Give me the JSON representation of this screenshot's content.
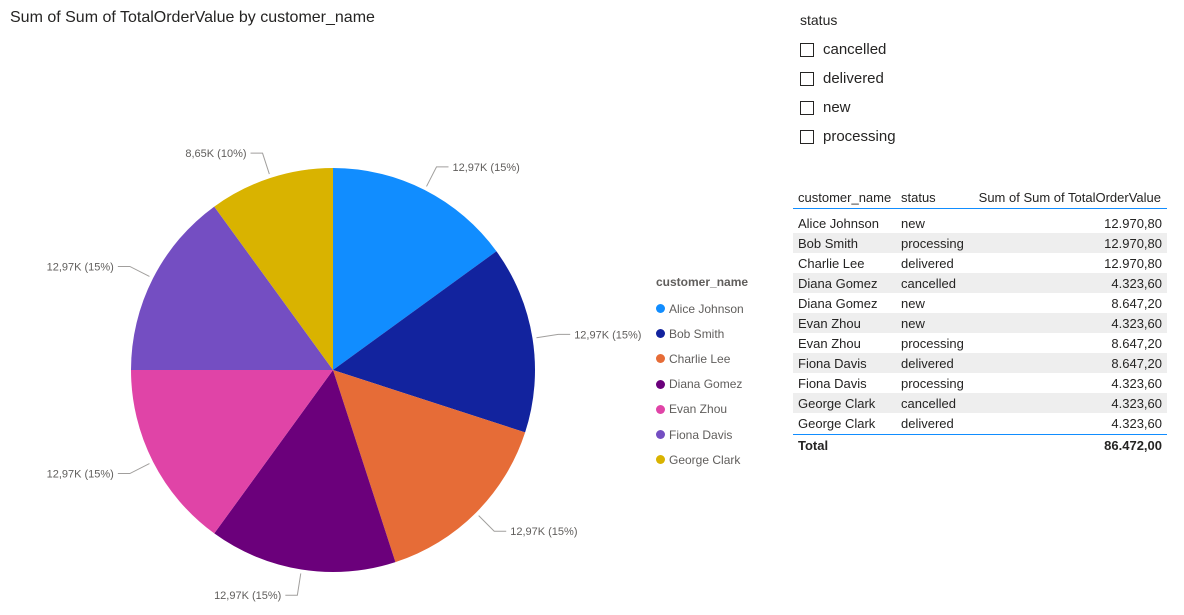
{
  "chart_title": "Sum of Sum of TotalOrderValue by customer_name",
  "chart_data": {
    "type": "pie",
    "title": "Sum of Sum of TotalOrderValue by customer_name",
    "legend_title": "customer_name",
    "legend_position": "right",
    "categories": [
      "Alice Johnson",
      "Bob Smith",
      "Charlie Lee",
      "Diana Gomez",
      "Evan Zhou",
      "Fiona Davis",
      "George Clark"
    ],
    "values": [
      12970.8,
      12970.8,
      12970.8,
      12970.8,
      12970.8,
      12970.8,
      8647.2
    ],
    "data_labels": [
      "12,97K (15%)",
      "12,97K (15%)",
      "12,97K (15%)",
      "12,97K (15%)",
      "12,97K (15%)",
      "12,97K (15%)",
      "8,65K (10%)"
    ],
    "colors": [
      "#118dff",
      "#12239e",
      "#e66c37",
      "#6b007b",
      "#e044a7",
      "#744ec2",
      "#d9b300"
    ]
  },
  "slicer": {
    "title": "status",
    "options": [
      "cancelled",
      "delivered",
      "new",
      "processing"
    ]
  },
  "table": {
    "headers": [
      "customer_name",
      "status",
      "Sum of Sum of TotalOrderValue"
    ],
    "rows": [
      [
        "Alice Johnson",
        "new",
        "12.970,80"
      ],
      [
        "Bob Smith",
        "processing",
        "12.970,80"
      ],
      [
        "Charlie Lee",
        "delivered",
        "12.970,80"
      ],
      [
        "Diana Gomez",
        "cancelled",
        "4.323,60"
      ],
      [
        "Diana Gomez",
        "new",
        "8.647,20"
      ],
      [
        "Evan Zhou",
        "new",
        "4.323,60"
      ],
      [
        "Evan Zhou",
        "processing",
        "8.647,20"
      ],
      [
        "Fiona Davis",
        "delivered",
        "8.647,20"
      ],
      [
        "Fiona Davis",
        "processing",
        "4.323,60"
      ],
      [
        "George Clark",
        "cancelled",
        "4.323,60"
      ],
      [
        "George Clark",
        "delivered",
        "4.323,60"
      ]
    ],
    "total_label": "Total",
    "total_value": "86.472,00"
  }
}
